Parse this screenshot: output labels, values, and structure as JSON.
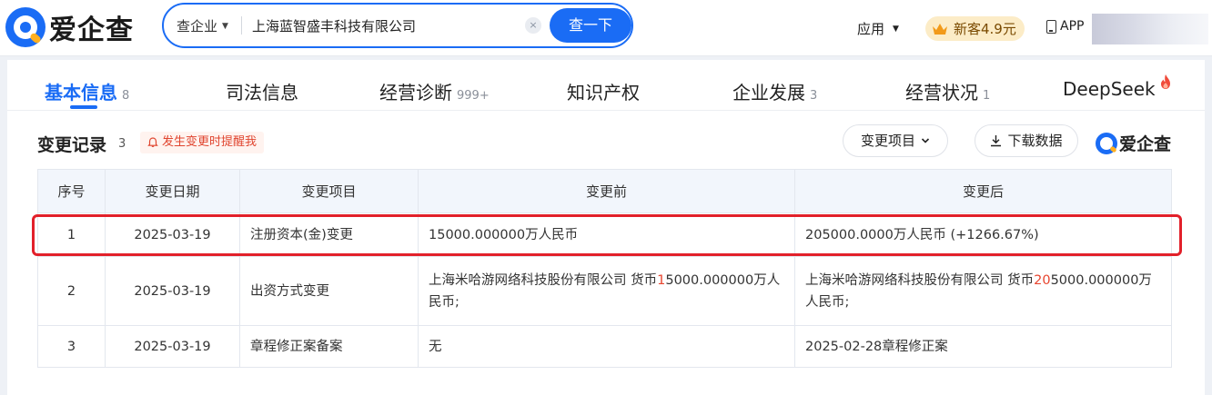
{
  "header": {
    "logo_text": "爱企查",
    "search": {
      "type_label": "查企业",
      "value": "上海蓝智盛丰科技有限公司",
      "clear_icon": "×",
      "button_label": "查一下"
    },
    "apps_label": "应用",
    "promo_label": "新客4.9元",
    "app_label": "APP"
  },
  "tabs": [
    {
      "label": "基本信息",
      "count": "8",
      "active": true
    },
    {
      "label": "司法信息",
      "count": ""
    },
    {
      "label": "经营诊断",
      "count": "999+"
    },
    {
      "label": "知识产权",
      "count": ""
    },
    {
      "label": "企业发展",
      "count": "3"
    },
    {
      "label": "经营状况",
      "count": "1"
    },
    {
      "label": "DeepSeek",
      "count": ""
    }
  ],
  "section": {
    "title": "变更记录",
    "count": "3",
    "remind_label": "发生变更时提醒我",
    "filter_label": "变更项目",
    "download_label": "下载数据",
    "brand_label": "爱企查"
  },
  "table": {
    "headers": [
      "序号",
      "变更日期",
      "变更项目",
      "变更前",
      "变更后"
    ],
    "rows": [
      {
        "index": "1",
        "date": "2025-03-19",
        "item": "注册资本(金)变更",
        "before": "15000.000000万人民币",
        "after": "205000.0000万人民币 (+1266.67%)"
      },
      {
        "index": "2",
        "date": "2025-03-19",
        "item": "出资方式变更",
        "before_prefix": "上海米哈游网络科技股份有限公司 货币",
        "before_highlight": "1",
        "before_suffix": "5000.000000万人民币;",
        "after_prefix": "上海米哈游网络科技股份有限公司 货币",
        "after_highlight": "20",
        "after_suffix": "5000.000000万人民币;"
      },
      {
        "index": "3",
        "date": "2025-03-19",
        "item": "章程修正案备案",
        "before": "无",
        "after": "2025-02-28章程修正案"
      }
    ]
  },
  "colors": {
    "brand_blue": "#1a6cf5",
    "change_red": "#e8452f",
    "highlight_box": "#e2202a"
  },
  "highlighted_row": "1"
}
